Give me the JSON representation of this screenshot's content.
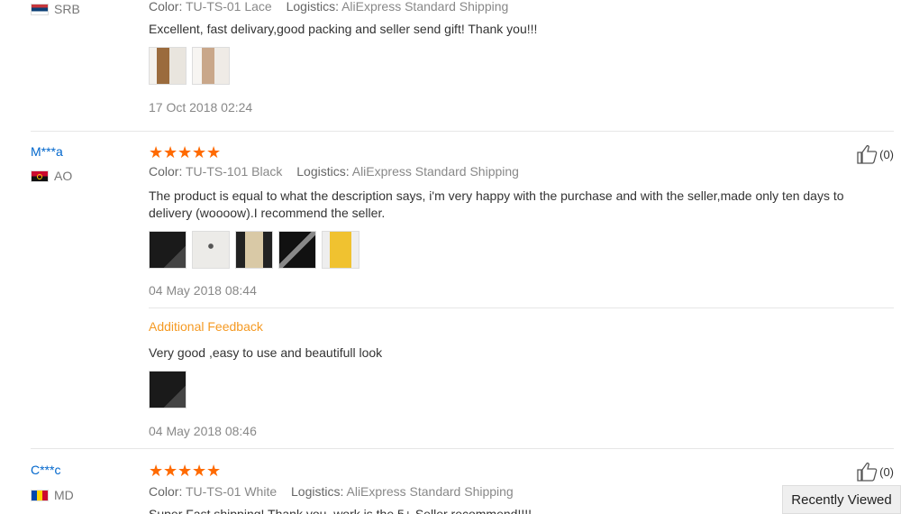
{
  "reviews": [
    {
      "user": "",
      "country": "SRB",
      "meta": {
        "color_label": "Color:",
        "color_value": "TU-TS-01 Lace",
        "log_label": "Logistics:",
        "log_value": "AliExpress Standard Shipping"
      },
      "text": "Excellent, fast delivary,good packing and seller send gift! Thank you!!!",
      "date": "17 Oct 2018 02:24"
    },
    {
      "user": "M***a",
      "country": "AO",
      "stars": 5,
      "likes": "(0)",
      "meta": {
        "color_label": "Color:",
        "color_value": "TU-TS-101 Black",
        "log_label": "Logistics:",
        "log_value": "AliExpress Standard Shipping"
      },
      "text": "The product is equal to what the description says, i'm very happy with the purchase and with the seller,made only ten days to delivery (woooow).I recommend the seller.",
      "date": "04 May 2018 08:44",
      "additional": {
        "label": "Additional Feedback",
        "text": "Very good ,easy to use and beautifull look",
        "date": "04 May 2018 08:46"
      }
    },
    {
      "user": "C***c",
      "country": "MD",
      "stars": 5,
      "likes": "(0)",
      "meta": {
        "color_label": "Color:",
        "color_value": "TU-TS-01 White",
        "log_label": "Logistics:",
        "log_value": "AliExpress Standard Shipping"
      },
      "text": "Super Fast shipping! Thank you, work is the 5+ Seller recommend!!!!"
    }
  ],
  "recently_viewed": "Recently Viewed",
  "colors": {
    "star": "#ff6a00",
    "link": "#0066cc",
    "accent": "#f59a23"
  }
}
